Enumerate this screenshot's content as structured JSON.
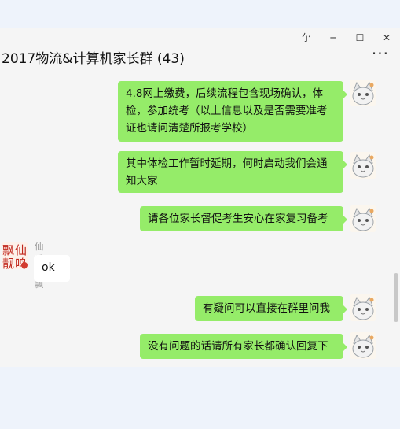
{
  "window": {
    "controls": {
      "pin": "亇",
      "minimize": "─",
      "maximize": "☐",
      "close": "✕"
    }
  },
  "header": {
    "title": "2017物流&计算机家长群 (43)",
    "more": "···"
  },
  "messages": [
    {
      "text_lines": [
        "4.8网上缴费，后续流程包含现场确认，体",
        "检，参加统考（以上信息以及是否需要准考",
        "证也请问清楚所报考学校）"
      ]
    },
    {
      "text_lines": [
        "其中体检工作暂时延期，何时启动我们会通",
        "知大家"
      ]
    },
    {
      "text_lines": [
        "请各位家长督促考生安心在家复习备考"
      ]
    },
    {
      "sender": "仙乐飘飘",
      "avatar_text": [
        "飘",
        "仙",
        "靓",
        "鸣"
      ],
      "text_lines": [
        "ok"
      ]
    },
    {
      "text_lines": [
        "有疑问可以直接在群里问我"
      ]
    },
    {
      "text_lines": [
        "没有问题的话请所有家长都确认回复下"
      ]
    }
  ],
  "colors": {
    "self_bubble": "#95ec69",
    "other_bubble": "#ffffff",
    "chat_bg": "#f5f5f5",
    "outer_bg": "#eef3fb"
  }
}
